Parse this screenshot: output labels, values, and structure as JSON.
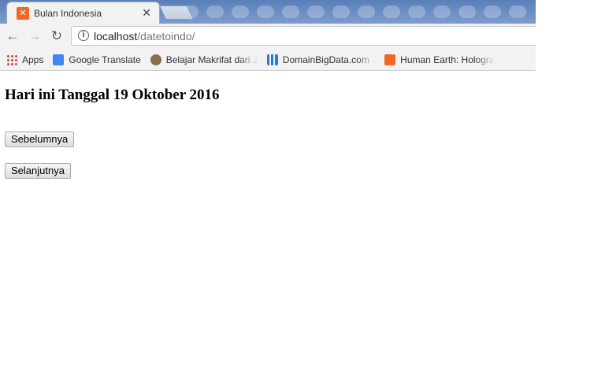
{
  "browser": {
    "tab": {
      "title": "Bulan Indonesia"
    },
    "url": {
      "host": "localhost",
      "path": "/datetoindo/"
    },
    "bookmarks": [
      {
        "label": "Apps",
        "icon": "apps-grid-icon"
      },
      {
        "label": "Google Translate",
        "icon": "google-translate-icon"
      },
      {
        "label": "Belajar Makrifat dari J",
        "icon": "avatar-icon"
      },
      {
        "label": "DomainBigData.com -",
        "icon": "bar-chart-icon"
      },
      {
        "label": "Human Earth: Hologra",
        "icon": "blogger-icon"
      }
    ]
  },
  "page": {
    "heading": "Hari ini Tanggal 19 Oktober 2016",
    "buttons": {
      "previous": "Sebelumnya",
      "next": "Selanjutnya"
    }
  }
}
